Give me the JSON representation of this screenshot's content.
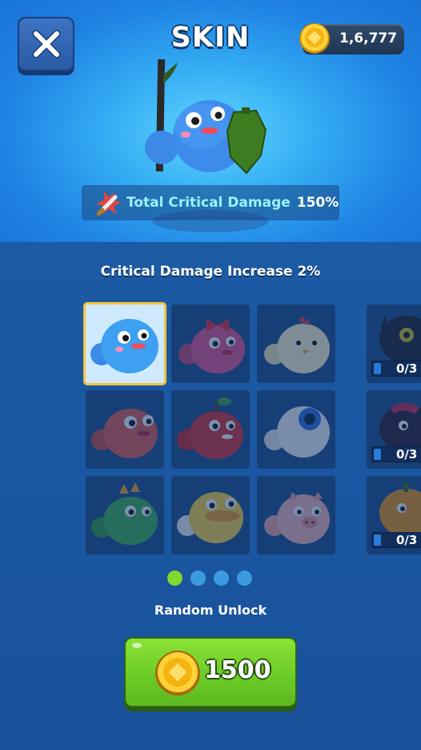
{
  "header": {
    "title": "SKIN",
    "coin_amount": "1,6,777"
  },
  "stat": {
    "label": "Total Critical Damage",
    "value": "150%"
  },
  "skin_bonus": "Critical Damage Increase 2%",
  "grid": {
    "skins": [
      {
        "name": "blue-blob",
        "color": "#3fa0f0",
        "selected": true
      },
      {
        "name": "pink-bow-blob",
        "color": "#e8508a",
        "selected": false
      },
      {
        "name": "chick-blob",
        "color": "#fff3c8",
        "selected": false
      },
      {
        "name": "red-blob",
        "color": "#e25a4a",
        "selected": false
      },
      {
        "name": "cherry-blob",
        "color": "#d82a2a",
        "selected": false
      },
      {
        "name": "eyeball-blob",
        "color": "#f4f4f4",
        "selected": false
      },
      {
        "name": "green-dino-blob",
        "color": "#3db04a",
        "selected": false
      },
      {
        "name": "duck-blob",
        "color": "#ffd43a",
        "selected": false
      },
      {
        "name": "pig-blob",
        "color": "#f4b6b4",
        "selected": false
      }
    ],
    "side_items": [
      {
        "name": "black-cat-blob",
        "count": "0/3"
      },
      {
        "name": "demon-blob",
        "count": "0/3"
      },
      {
        "name": "pumpkin-blob",
        "count": "0/3"
      }
    ]
  },
  "pagination": {
    "total": 4,
    "active": 0
  },
  "unlock": {
    "label": "Random Unlock",
    "price": "1500"
  },
  "colors": {
    "accent_green": "#7ed82e",
    "stat_text": "#9ef0ff",
    "selected_border": "#f5c33b"
  }
}
